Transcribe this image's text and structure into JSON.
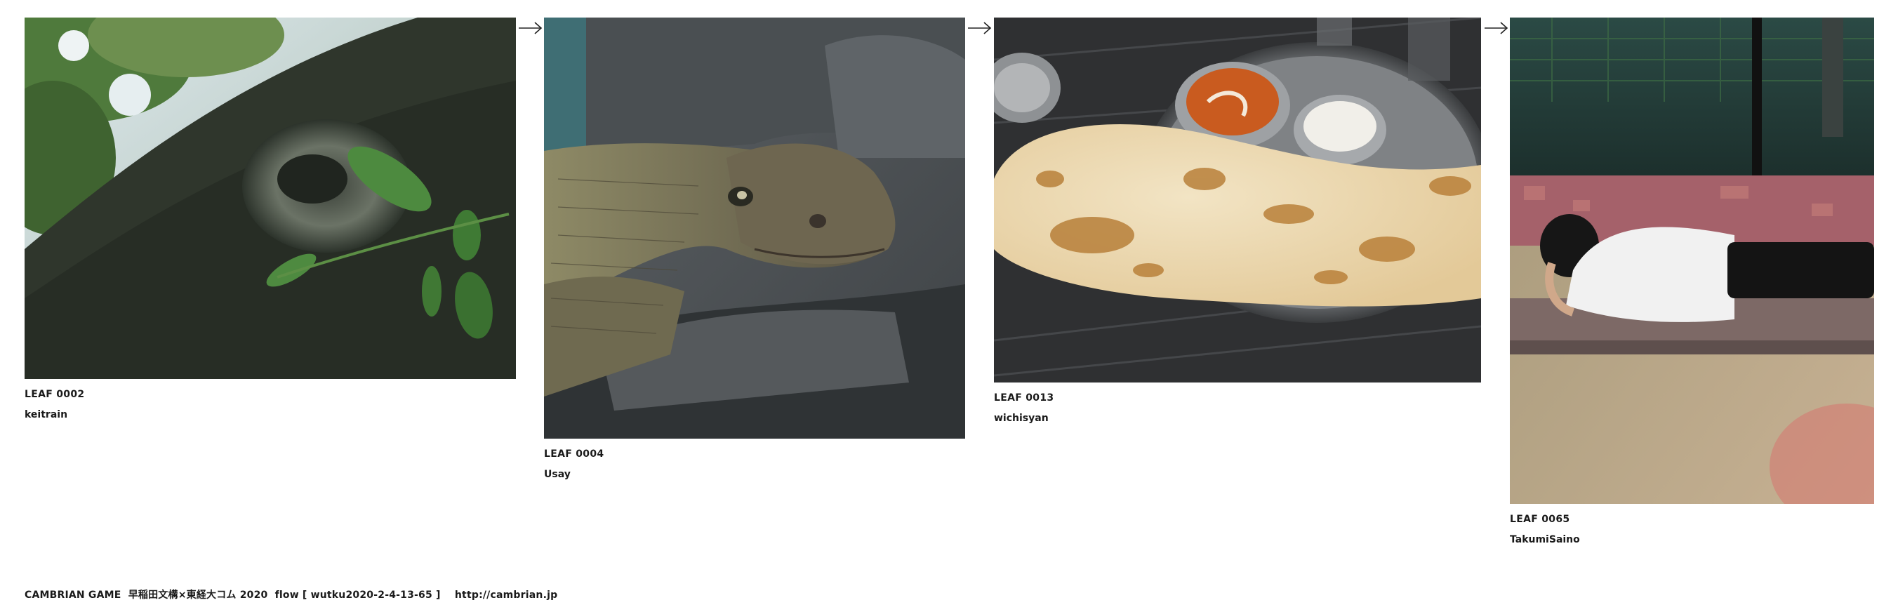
{
  "leaves": [
    {
      "id": "LEAF 0002",
      "author": "keitrain",
      "image": "tree-trunk-with-green-leaves-photo"
    },
    {
      "id": "LEAF 0004",
      "author": "Usay",
      "image": "lizard-on-rock-photo"
    },
    {
      "id": "LEAF 0013",
      "author": "wichisyan",
      "image": "naan-and-curry-plate-photo"
    },
    {
      "id": "LEAF 0065",
      "author": "TakumiSaino",
      "image": "person-lying-on-train-seat-photo"
    }
  ],
  "arrows": [
    "arrow-right-icon",
    "arrow-right-icon",
    "arrow-right-icon"
  ],
  "footer": {
    "text": "CAMBRIAN GAME  早稲田文構×東経大コム 2020  flow [ wutku2020-2-4-13-65 ]    http://cambrian.jp"
  }
}
